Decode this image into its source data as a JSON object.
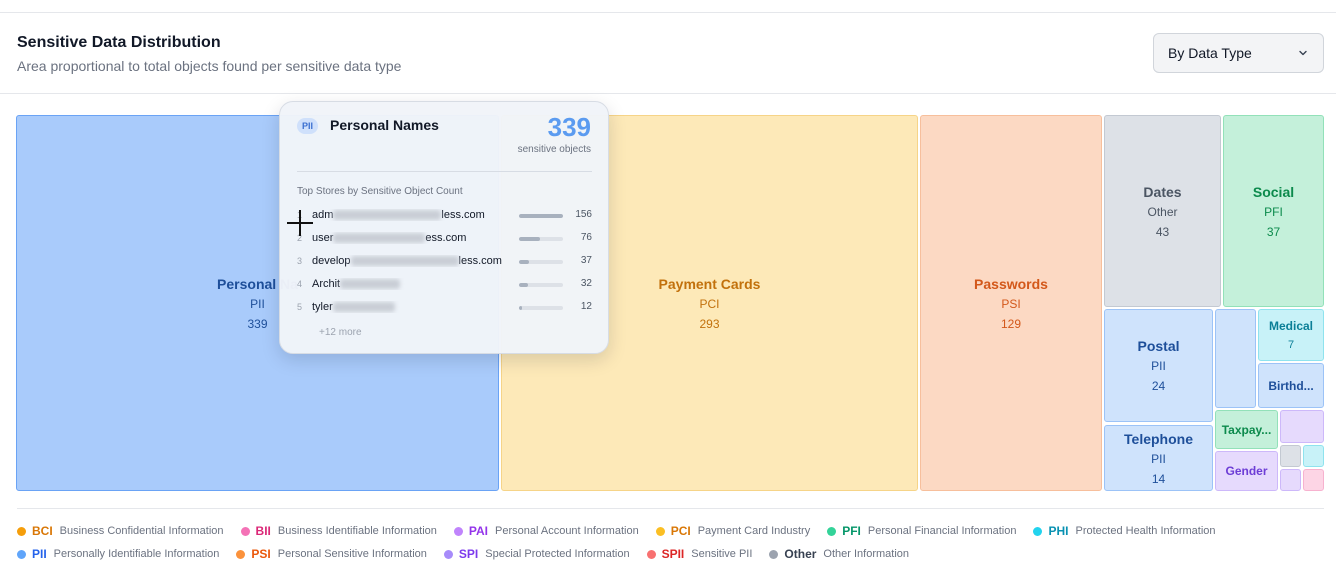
{
  "header": {
    "title": "Sensitive Data Distribution",
    "subtitle": "Area proportional to total objects found per sensitive data type",
    "dropdown_value": "By Data Type"
  },
  "chart_data": {
    "type": "treemap",
    "metric": "total sensitive objects per data type",
    "items": [
      {
        "name": "Personal Na",
        "category": "PII",
        "value": 339,
        "color": "#a9cbfb"
      },
      {
        "name": "Payment Cards",
        "category": "PCI",
        "value": 293,
        "color": "#fde9b8"
      },
      {
        "name": "Passwords",
        "category": "PSI",
        "value": 129,
        "color": "#fcd9c3"
      },
      {
        "name": "Dates",
        "category": "Other",
        "value": 43,
        "color": "#dde1e7"
      },
      {
        "name": "Social",
        "category": "PFI",
        "value": 37,
        "color": "#c4f0da"
      },
      {
        "name": "Postal",
        "category": "PII",
        "value": 24,
        "color": "#cfe3fc"
      },
      {
        "name": "Telephone",
        "category": "PII",
        "value": 14,
        "color": "#cfe3fc"
      },
      {
        "name": "Medical",
        "category": "PHI",
        "value": 7,
        "color": "#c8f2f8"
      },
      {
        "name": "Birthd...",
        "category": "PII",
        "color": "#cfe3fc"
      },
      {
        "name": "Taxpay...",
        "category": "PFI",
        "color": "#c4f0da"
      },
      {
        "name": "Gender",
        "category": "SPI",
        "color": "#e6dafd"
      }
    ],
    "unlabeled_tiles": [
      {
        "category": "PII",
        "color": "#cfe3fc"
      },
      {
        "category": "SPI",
        "color": "#e6dafd"
      },
      {
        "category": "Other",
        "color": "#dde1e7"
      },
      {
        "category": "PHI",
        "color": "#c8f2f8"
      },
      {
        "category": "SPI",
        "color": "#e6dafd"
      },
      {
        "category": "BII",
        "color": "#fdd5e5"
      }
    ]
  },
  "tooltip": {
    "badge": "PII",
    "title": "Personal Names",
    "count": "339",
    "count_label": "sensitive objects",
    "section_title": "Top Stores by Sensitive Object Count",
    "stores": [
      {
        "rank": "1",
        "prefix": "adm",
        "suffix": "less.com",
        "value": 156,
        "value_label": "156"
      },
      {
        "rank": "2",
        "prefix": "user",
        "suffix": "ess.com",
        "value": 76,
        "value_label": "76"
      },
      {
        "rank": "3",
        "prefix": "develop",
        "suffix": "less.com",
        "value": 37,
        "value_label": "37"
      },
      {
        "rank": "4",
        "prefix": "Archit",
        "suffix": "",
        "value": 32,
        "value_label": "32"
      },
      {
        "rank": "5",
        "prefix": "tyler",
        "suffix": "",
        "value": 12,
        "value_label": "12"
      }
    ],
    "more": "+12 more"
  },
  "legend": [
    {
      "code": "BCI",
      "desc": "Business Confidential Information",
      "color": "#f59e0b"
    },
    {
      "code": "BII",
      "desc": "Business Identifiable Information",
      "color": "#f472b6"
    },
    {
      "code": "PAI",
      "desc": "Personal Account Information",
      "color": "#c084fc"
    },
    {
      "code": "PCI",
      "desc": "Payment Card Industry",
      "color": "#fbbf24"
    },
    {
      "code": "PFI",
      "desc": "Personal Financial Information",
      "color": "#34d399"
    },
    {
      "code": "PHI",
      "desc": "Protected Health Information",
      "color": "#22d3ee"
    },
    {
      "code": "PII",
      "desc": "Personally Identifiable Information",
      "color": "#60a5fa"
    },
    {
      "code": "PSI",
      "desc": "Personal Sensitive Information",
      "color": "#fb923c"
    },
    {
      "code": "SPI",
      "desc": "Special Protected Information",
      "color": "#a78bfa"
    },
    {
      "code": "SPII",
      "desc": "Sensitive PII",
      "color": "#f87171"
    },
    {
      "code": "Other",
      "desc": "Other Information",
      "color": "#9ca3af"
    }
  ],
  "legend_code_colors": {
    "BCI": "#d97706",
    "BII": "#db2777",
    "PAI": "#9333ea",
    "PCI": "#d97706",
    "PFI": "#059669",
    "PHI": "#0891b2",
    "PII": "#2563eb",
    "PSI": "#ea580c",
    "SPI": "#7c3aed",
    "SPII": "#dc2626",
    "Other": "#374151"
  }
}
